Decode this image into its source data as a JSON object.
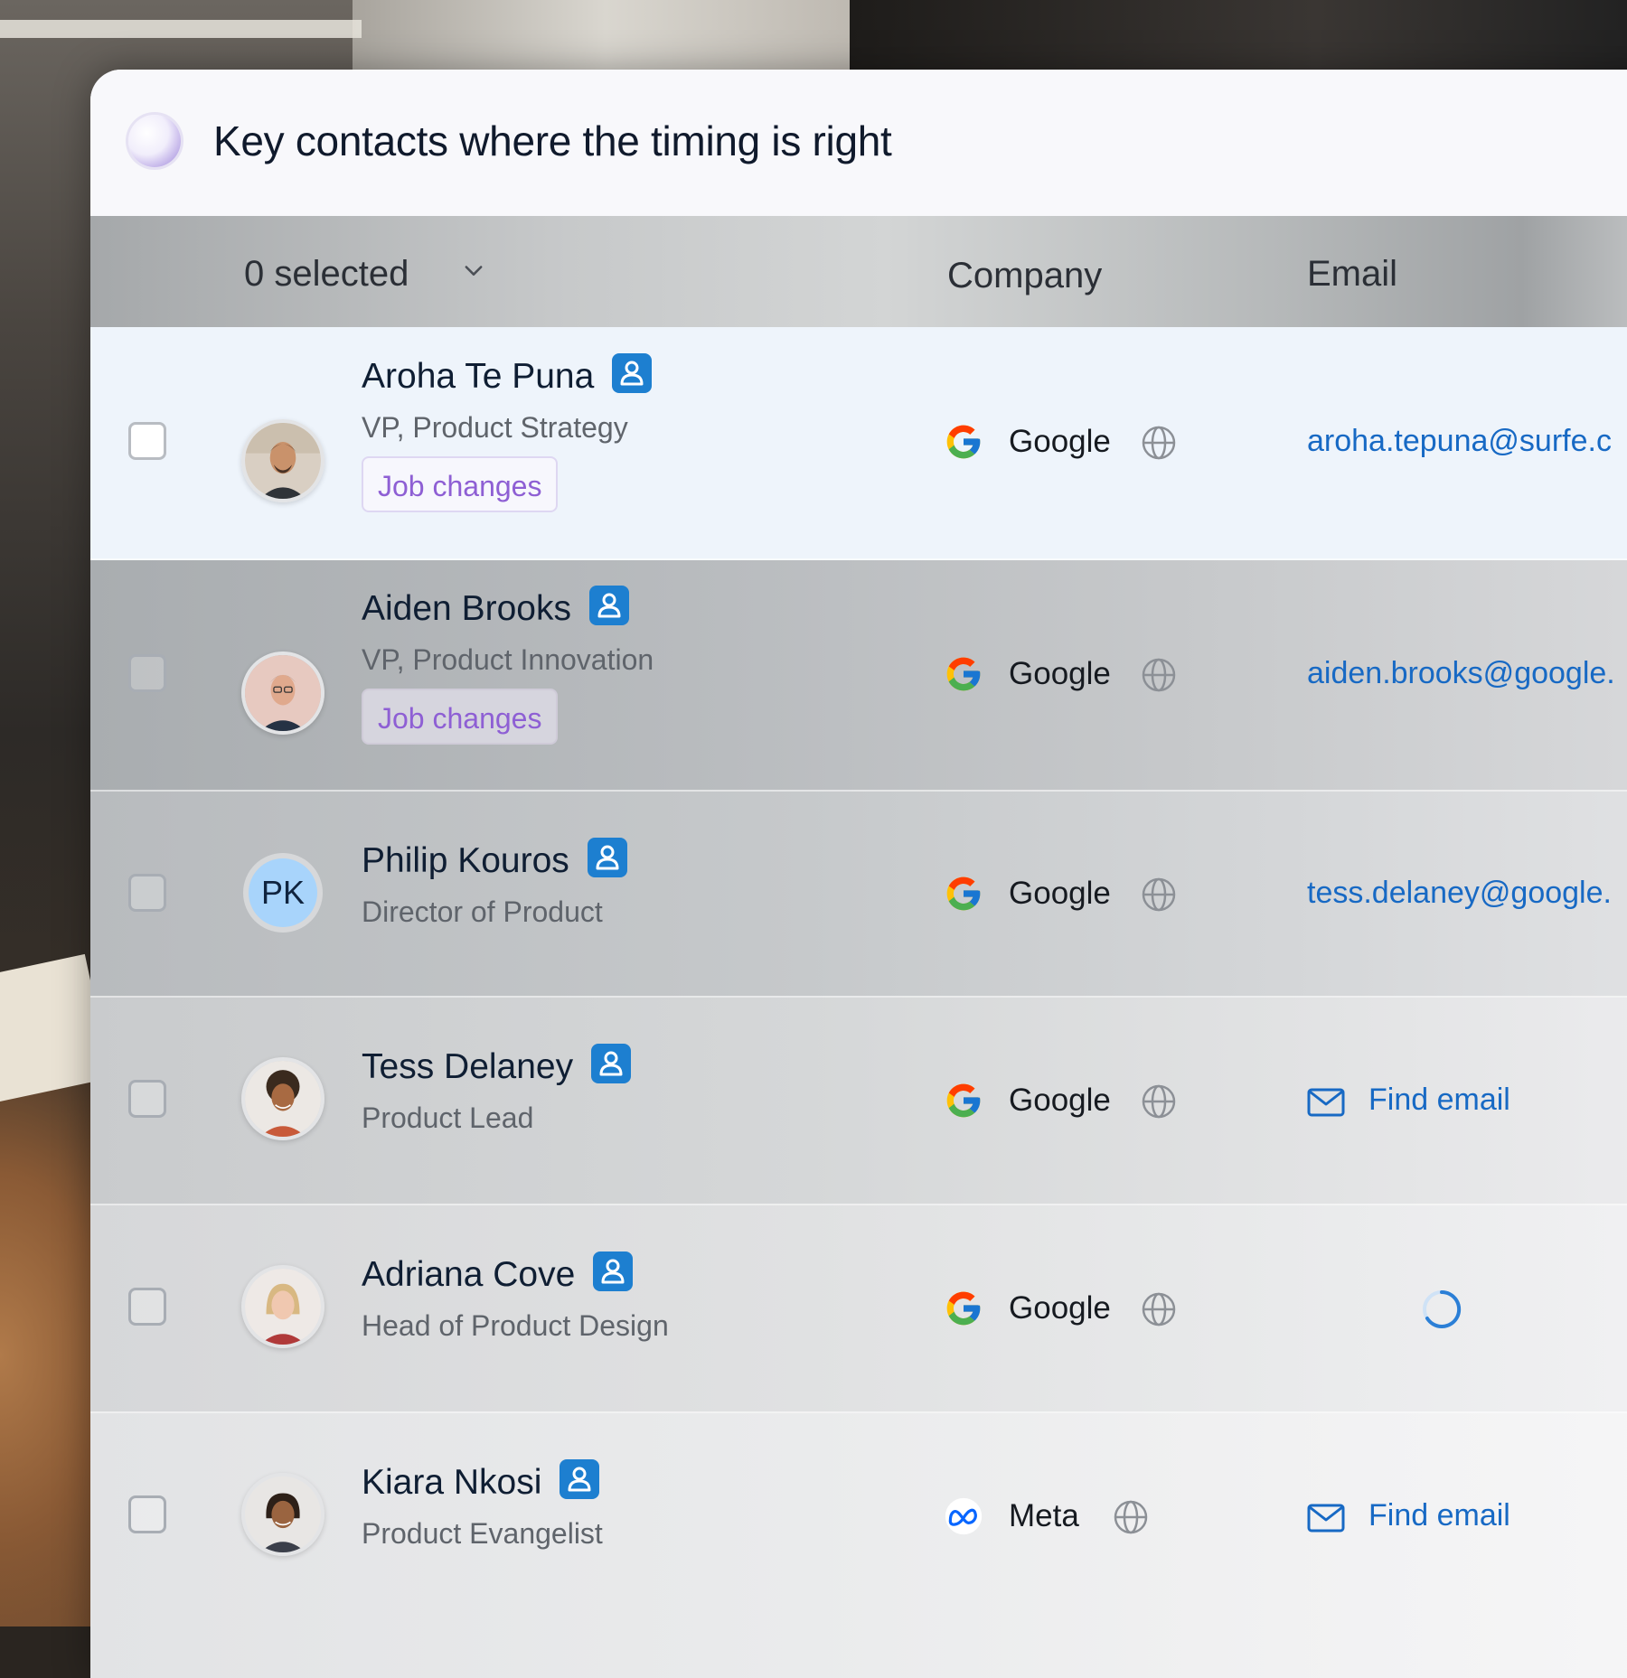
{
  "header": {
    "title": "Key contacts where the timing is right"
  },
  "table_header": {
    "selected_label": "0 selected",
    "company_label": "Company",
    "email_label": "Email"
  },
  "contacts": [
    {
      "name": "Aroha Te Puna",
      "role": "VP, Product Strategy",
      "tag": "Job changes",
      "company": "Google",
      "email": "aroha.tepuna@surfe.c"
    },
    {
      "name": "Aiden Brooks",
      "role": "VP, Product Innovation",
      "tag": "Job changes",
      "company": "Google",
      "email": "aiden.brooks@google."
    },
    {
      "name": "Philip Kouros",
      "initials": "PK",
      "role": "Director of Product",
      "company": "Google",
      "email": "tess.delaney@google."
    },
    {
      "name": "Tess Delaney",
      "role": "Product Lead",
      "company": "Google",
      "email_action": "Find email"
    },
    {
      "name": "Adriana Cove",
      "role": "Head of Product Design",
      "company": "Google",
      "email_status": "loading"
    },
    {
      "name": "Kiara Nkosi",
      "role": "Product Evangelist",
      "company": "Meta",
      "email_action": "Find email"
    }
  ],
  "colors": {
    "accent_blue": "#1769c4",
    "badge_blue": "#1d7fd0",
    "tag_purple": "#8e5fd4",
    "initials_bg": "#a8d4fb"
  }
}
